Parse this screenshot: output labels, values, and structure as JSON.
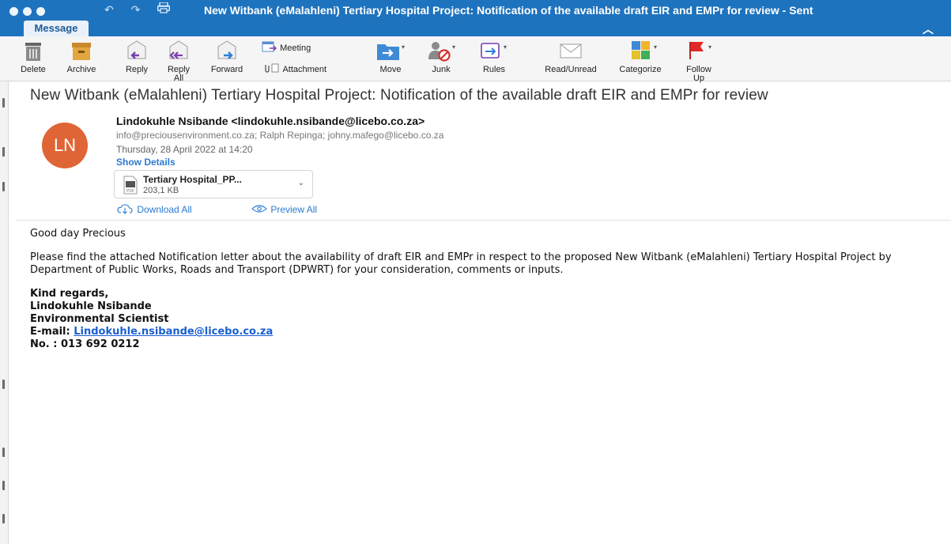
{
  "window": {
    "title": "New Witbank (eMalahleni) Tertiary Hospital Project: Notification of the available draft EIR and EMPr for review - Sent"
  },
  "ribbon": {
    "active_tab": "Message",
    "buttons": {
      "delete": "Delete",
      "archive": "Archive",
      "reply": "Reply",
      "reply_all_1": "Reply",
      "reply_all_2": "All",
      "forward": "Forward",
      "meeting": "Meeting",
      "attachment": "Attachment",
      "move": "Move",
      "junk": "Junk",
      "rules": "Rules",
      "read_unread": "Read/Unread",
      "categorize": "Categorize",
      "follow_up_1": "Follow",
      "follow_up_2": "Up"
    }
  },
  "message": {
    "subject": "New Witbank (eMalahleni) Tertiary Hospital Project: Notification of the available draft EIR and EMPr for review",
    "avatar_initials": "LN",
    "from": "Lindokuhle Nsibande <lindokuhle.nsibande@licebo.co.za>",
    "recipients": "info@preciousenvironment.co.za;  Ralph Repinga;  johny.mafego@licebo.co.za",
    "date": "Thursday, 28 April 2022 at 14:20",
    "show_details": "Show Details",
    "attachment": {
      "name": "Tertiary Hospital_PP...",
      "size": "203,1 KB"
    },
    "download_all": "Download All",
    "preview_all": "Preview All",
    "greeting": "Good day Precious",
    "body_text": "Please find the attached Notification letter about the availability of draft EIR and EMPr in respect to the proposed New Witbank (eMalahleni) Tertiary Hospital Project by Department of Public Works, Roads and Transport (DPWRT) for your consideration, comments or inputs.",
    "signature": {
      "closing": "Kind regards,",
      "name": "Lindokuhle Nsibande",
      "role": "Environmental Scientist",
      "email_label": "E-mail: ",
      "email": "Lindokuhle.nsibande@licebo.co.za",
      "phone": "No. : 013 692 0212"
    }
  },
  "colors": {
    "titlebar": "#1e73be",
    "avatar": "#e06536",
    "link": "#2b7ad0"
  }
}
